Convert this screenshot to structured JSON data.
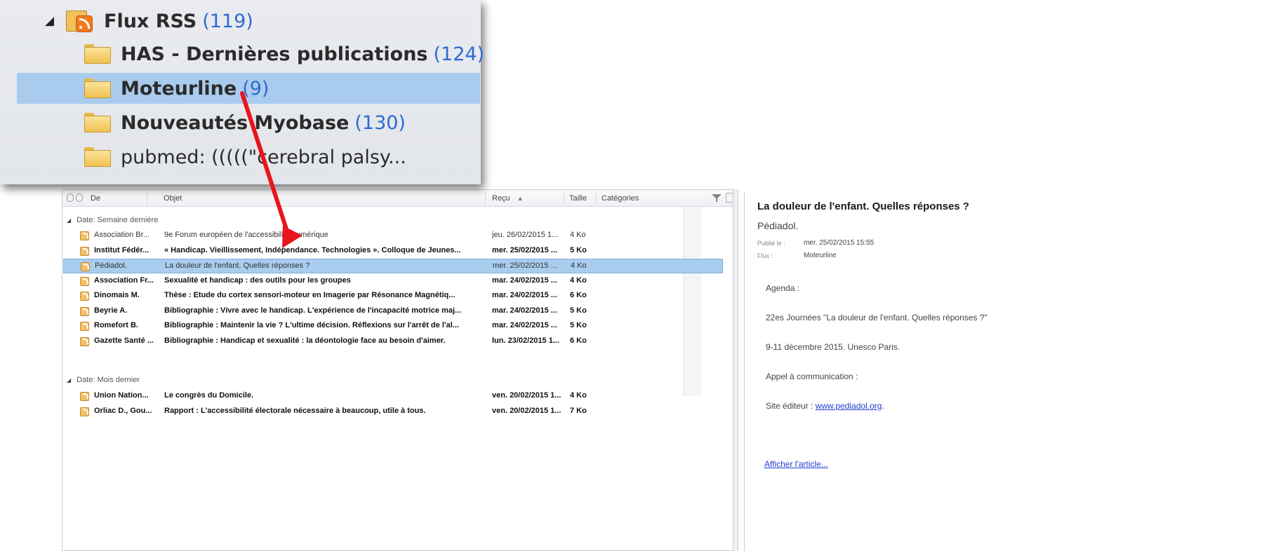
{
  "tree": {
    "root": {
      "label": "Flux RSS",
      "count": "(119)"
    },
    "folders": [
      {
        "label": "HAS - Dernières publications",
        "count": "(124)"
      },
      {
        "label": "Moteurline",
        "count": "(9)"
      },
      {
        "label": "Nouveautés Myobase",
        "count": "(130)"
      },
      {
        "label": "pubmed: (((((\"cerebral palsy...",
        "count": ""
      }
    ]
  },
  "list": {
    "columns": {
      "from": "De",
      "subject": "Objet",
      "received": "Reçu",
      "size": "Taille",
      "categories": "Catégories"
    },
    "groups": [
      {
        "label": "Date: Semaine dernière",
        "rows": [
          {
            "from": "Association Br...",
            "subject": "9e Forum européen de l'accessibilité numérique",
            "date": "jeu. 26/02/2015 1...",
            "size": "4 Ko",
            "unread": false,
            "selected": false
          },
          {
            "from": "Institut Fédér...",
            "subject": "« Handicap. Vieillissement, Indépendance. Technologies ». Colloque de Jeunes...",
            "date": "mer. 25/02/2015 ...",
            "size": "5 Ko",
            "unread": true,
            "selected": false
          },
          {
            "from": "Pédiadol.",
            "subject": "La douleur de l'enfant. Quelles réponses ?",
            "date": "mer. 25/02/2015 ...",
            "size": "4 Ko",
            "unread": false,
            "selected": true
          },
          {
            "from": "Association Fr...",
            "subject": "Sexualité et handicap : des outils pour les groupes",
            "date": "mar. 24/02/2015 ...",
            "size": "4 Ko",
            "unread": true,
            "selected": false
          },
          {
            "from": "Dinomais M.",
            "subject": "Thèse : Etude du cortex sensori-moteur en Imagerie par Résonance Magnétiq...",
            "date": "mar. 24/02/2015 ...",
            "size": "6 Ko",
            "unread": true,
            "selected": false
          },
          {
            "from": "Beyrie A.",
            "subject": "Bibliographie : Vivre avec le handicap. L'expérience de l'incapacité motrice maj...",
            "date": "mar. 24/02/2015 ...",
            "size": "5 Ko",
            "unread": true,
            "selected": false
          },
          {
            "from": "Romefort B.",
            "subject": "Bibliographie : Maintenir la vie ? L'ultime décision. Réflexions sur l'arrêt de l'al...",
            "date": "mar. 24/02/2015 ...",
            "size": "5 Ko",
            "unread": true,
            "selected": false
          },
          {
            "from": "Gazette Santé ...",
            "subject": "Bibliographie : Handicap et sexualité : la déontologie face au besoin d'aimer.",
            "date": "lun. 23/02/2015 1...",
            "size": "6 Ko",
            "unread": true,
            "selected": false
          }
        ]
      },
      {
        "label": "Date: Mois dernier",
        "rows": [
          {
            "from": "Union Nation...",
            "subject": "Le congrès du Domicile.",
            "date": "ven. 20/02/2015 1...",
            "size": "4 Ko",
            "unread": true,
            "selected": false
          },
          {
            "from": "Orliac D., Gou...",
            "subject": "Rapport : L'accessibilité électorale nécessaire à beaucoup, utile à tous.",
            "date": "ven. 20/02/2015 1...",
            "size": "7 Ko",
            "unread": true,
            "selected": false
          }
        ]
      }
    ]
  },
  "reading": {
    "title": "La douleur de l'enfant. Quelles réponses ?",
    "author": "Pédiadol.",
    "published_label": "Publié le :",
    "published_value": "mer. 25/02/2015 15:55",
    "feed_label": "Flux :",
    "feed_value": "Moteurline",
    "agenda": "Agenda :",
    "event": "22es Journées \"La douleur de l'enfant. Quelles réponses ?\"",
    "dates": "9-11 décembre 2015. Unesco Paris.",
    "call": "Appel à communication :",
    "site_label": "Site éditeur : ",
    "site_link": "www.pediadol.org",
    "site_period": ".",
    "article_link": "Afficher l'article..."
  },
  "colors": {
    "selection": "#a9cdee",
    "tree_selection": "#a8cbee",
    "count_blue": "#2c6ad4",
    "link_blue": "#1d3fcf",
    "arrow_red": "#e8141c"
  },
  "icons": [
    "expand-arrow-icon",
    "rss-folder-icon",
    "folder-icon",
    "rss-item-icon",
    "filter-icon",
    "sort-arrow-icon"
  ]
}
